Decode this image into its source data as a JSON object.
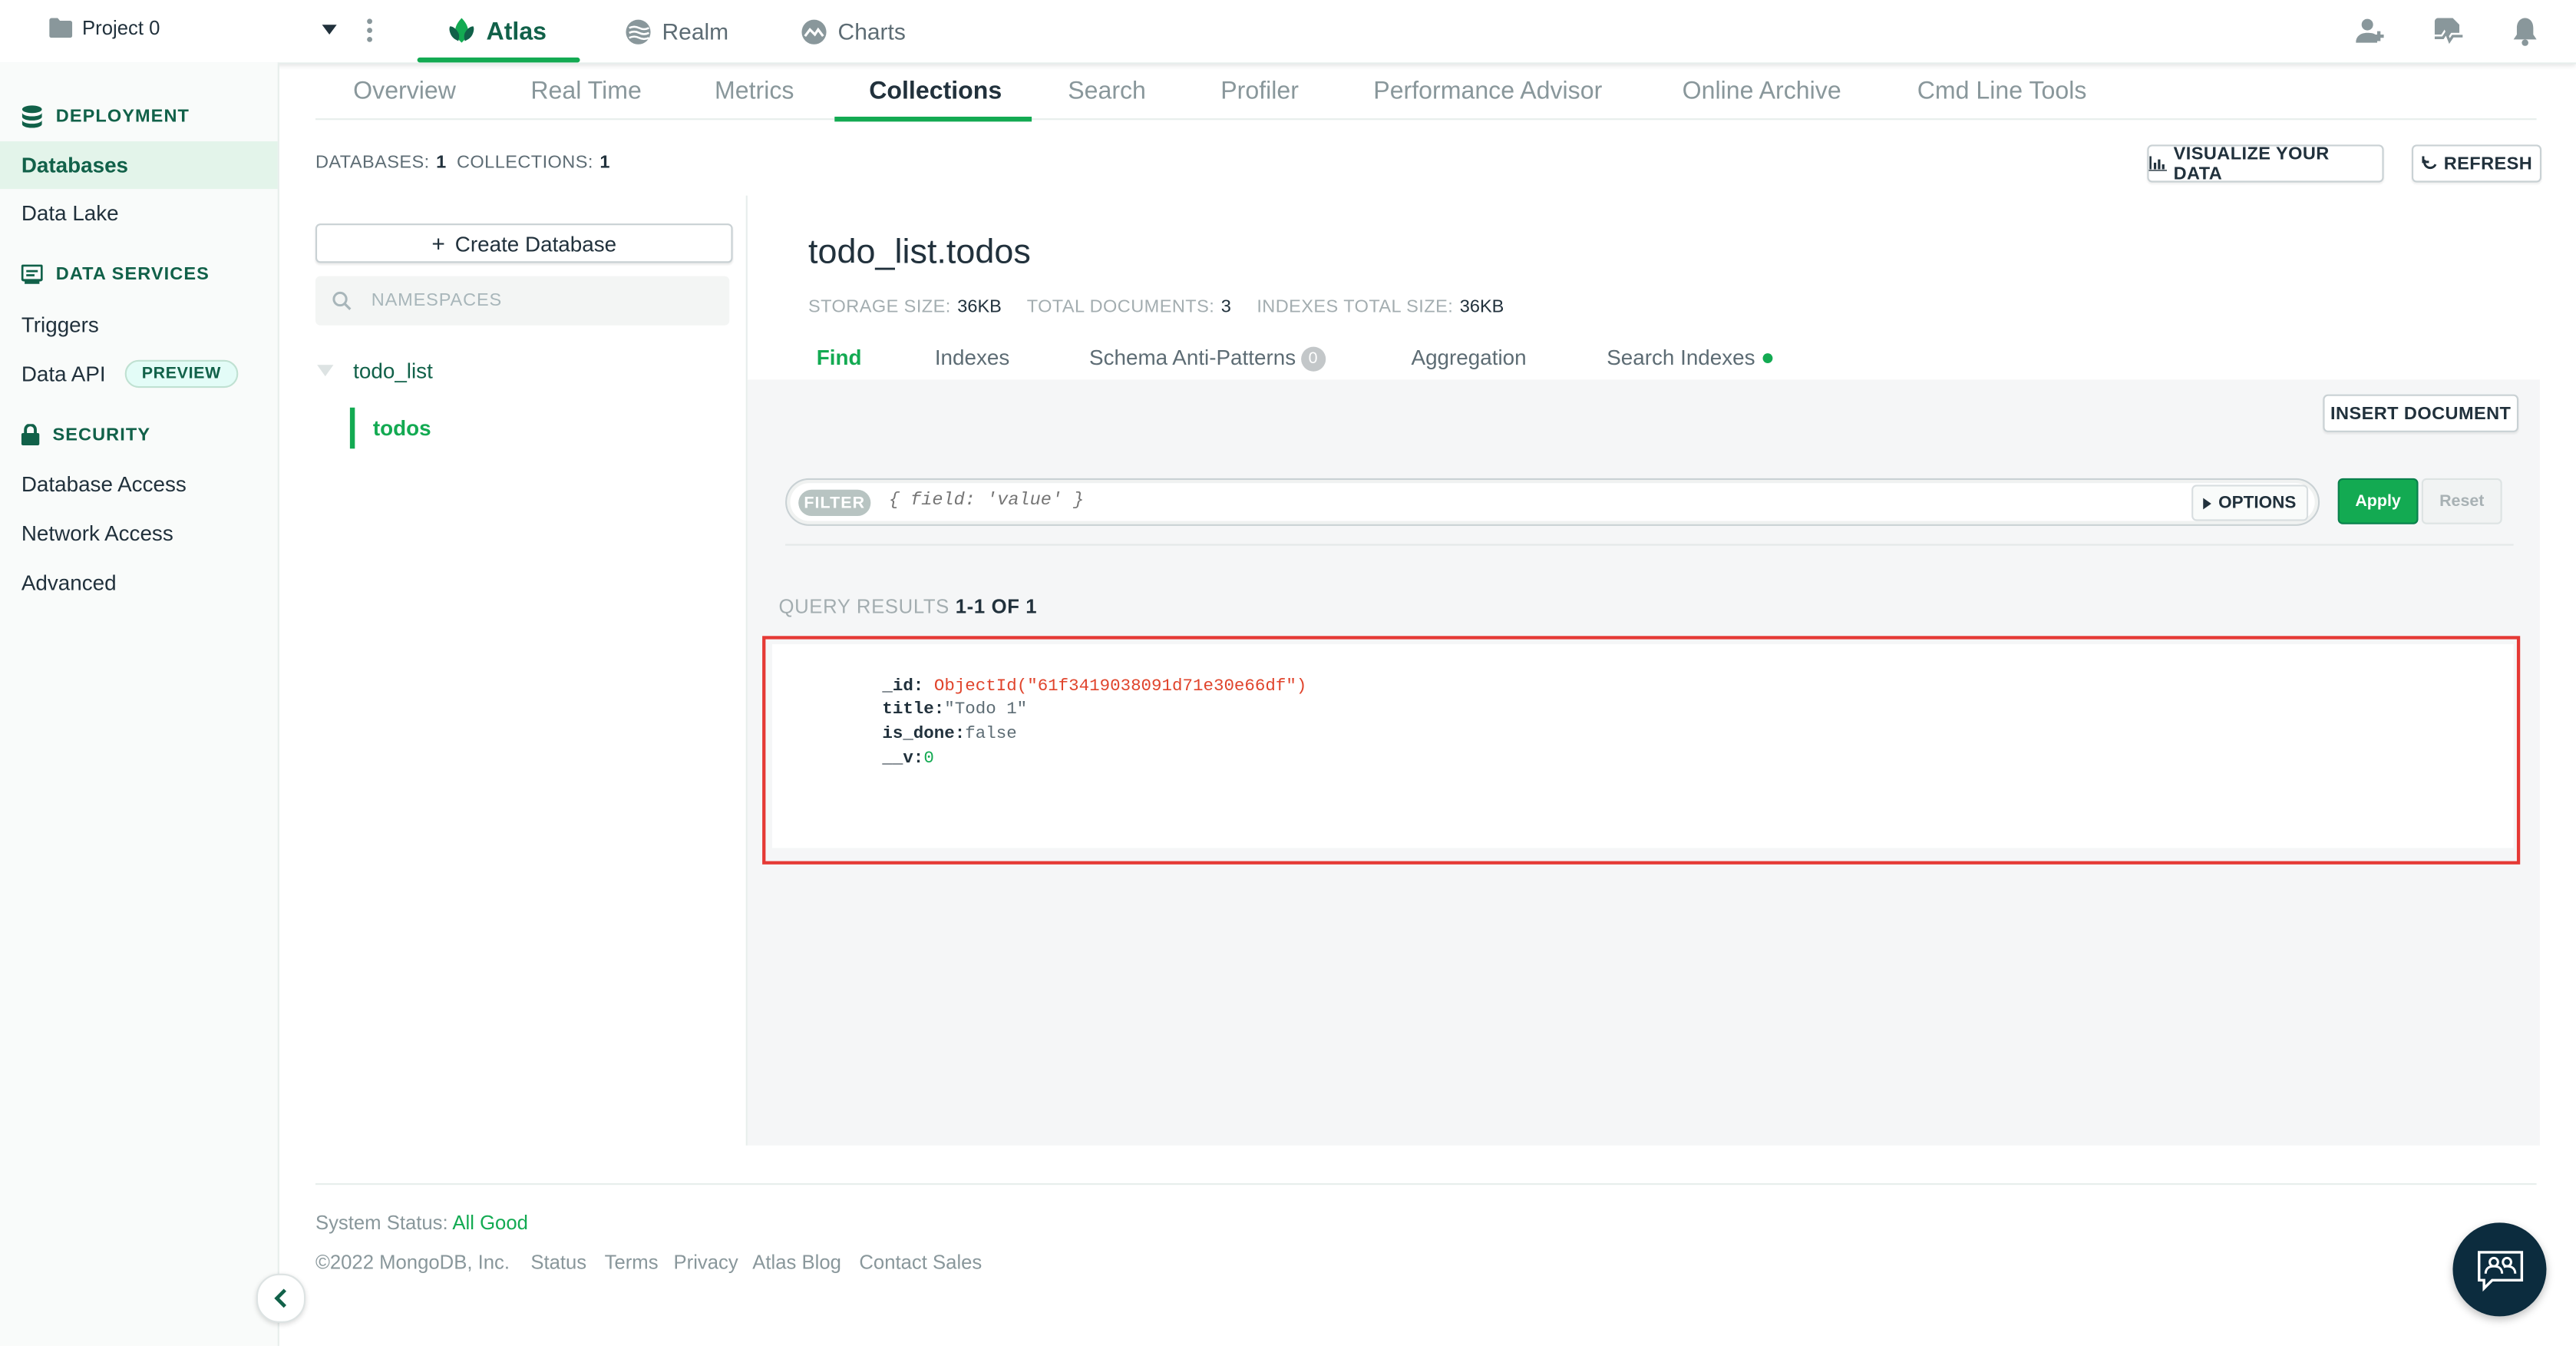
{
  "topbar": {
    "project_name": "Project 0",
    "products": [
      "Atlas",
      "Realm",
      "Charts"
    ],
    "icons": [
      "folder-icon",
      "caret-down-icon",
      "more-vert-icon",
      "add-user-icon",
      "activity-icon",
      "bell-icon"
    ]
  },
  "sidebar": {
    "deployment": {
      "header": "DEPLOYMENT",
      "items": [
        "Databases",
        "Data Lake"
      ]
    },
    "data_services": {
      "header": "DATA SERVICES",
      "items": [
        "Triggers",
        "Data API"
      ],
      "preview_badge": "PREVIEW"
    },
    "security": {
      "header": "SECURITY",
      "items": [
        "Database Access",
        "Network Access",
        "Advanced"
      ]
    },
    "active_item": "Databases"
  },
  "subnav": {
    "tabs": [
      "Overview",
      "Real Time",
      "Metrics",
      "Collections",
      "Search",
      "Profiler",
      "Performance Advisor",
      "Online Archive",
      "Cmd Line Tools"
    ],
    "active": "Collections"
  },
  "summary": {
    "databases_label": "DATABASES:",
    "databases_value": "1",
    "collections_label": "COLLECTIONS:",
    "collections_value": "1"
  },
  "actions": {
    "visualize": "VISUALIZE YOUR DATA",
    "refresh": "REFRESH"
  },
  "dblist": {
    "create_button": "Create Database",
    "search_placeholder": "NAMESPACES",
    "database": "todo_list",
    "collection": "todos"
  },
  "collection": {
    "title": "todo_list.todos",
    "storage_label": "STORAGE SIZE:",
    "storage_value": "36KB",
    "docs_label": "TOTAL DOCUMENTS:",
    "docs_value": "3",
    "indexes_label": "INDEXES TOTAL SIZE:",
    "indexes_value": "36KB",
    "tabs": [
      "Find",
      "Indexes",
      "Schema Anti-Patterns",
      "Aggregation",
      "Search Indexes"
    ],
    "schema_count": "0",
    "active_tab": "Find"
  },
  "find": {
    "insert_button": "INSERT DOCUMENT",
    "filter_label": "FILTER",
    "filter_placeholder": "{ field: 'value' }",
    "options_label": "OPTIONS",
    "apply": "Apply",
    "reset": "Reset",
    "results_label": "QUERY RESULTS",
    "results_range": "1-1 OF 1"
  },
  "document": {
    "fields": [
      {
        "key": "_id:",
        "value": "ObjectId(\"61f3419038091d71e30e66df\")",
        "type": "oid"
      },
      {
        "key": "title:",
        "value": "\"Todo 1\"",
        "type": "str"
      },
      {
        "key": "is_done:",
        "value": "false",
        "type": "bool"
      },
      {
        "key": "__v:",
        "value": "0",
        "type": "num"
      }
    ]
  },
  "footer": {
    "status_label": "System Status:",
    "status_value": "All Good",
    "copyright": "©2022 MongoDB, Inc.",
    "links": [
      "Status",
      "Terms",
      "Privacy",
      "Atlas Blog",
      "Contact Sales"
    ]
  },
  "colors": {
    "accent": "#13aa52",
    "dark_green": "#116149",
    "highlight_border": "#e53935",
    "oid": "#e0442c"
  }
}
